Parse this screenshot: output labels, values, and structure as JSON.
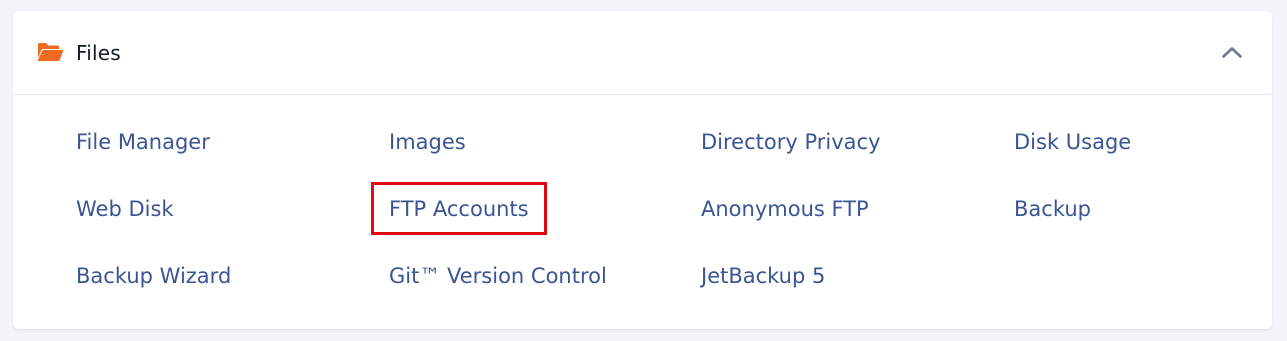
{
  "panel": {
    "title": "Files",
    "icon": "folder-open-icon",
    "toggle_icon": "chevron-up-icon",
    "accent_color": "#f26a21",
    "highlight_color": "#e00b12"
  },
  "links": [
    "File Manager",
    "Images",
    "Directory Privacy",
    "Disk Usage",
    "Web Disk",
    "FTP Accounts",
    "Anonymous FTP",
    "Backup",
    "Backup Wizard",
    "Git™ Version Control",
    "JetBackup 5"
  ],
  "highlighted_link": "FTP Accounts"
}
